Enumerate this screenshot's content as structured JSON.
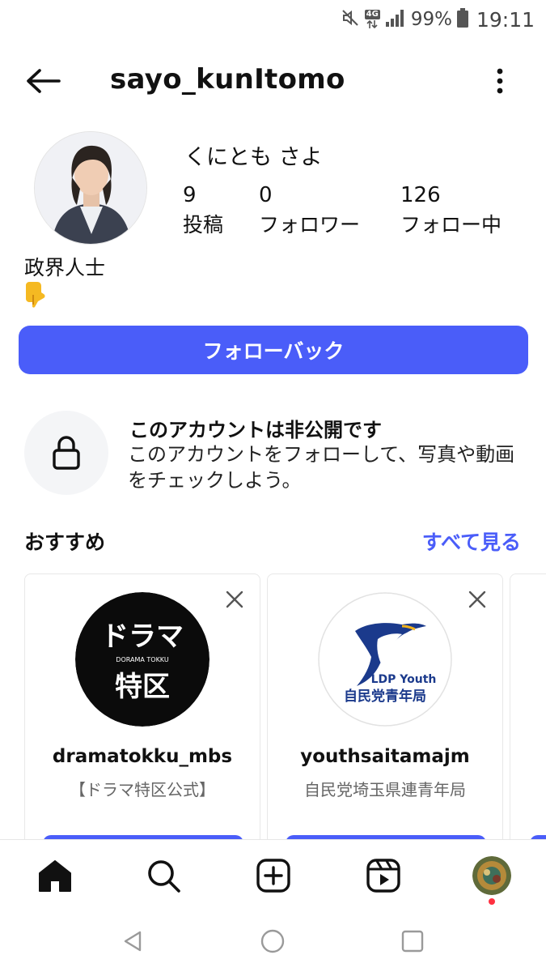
{
  "status_bar": {
    "network": "4G",
    "battery": "99%",
    "time": "19:11",
    "icons": [
      "mute-icon",
      "data-arrows-icon",
      "signal-icon",
      "battery-icon"
    ]
  },
  "header": {
    "username": "sayo_kunItomo",
    "back_icon": "arrow-left-icon",
    "more_icon": "more-vertical-icon"
  },
  "profile": {
    "display_name": "くにとも さよ",
    "stats": [
      {
        "value": "9",
        "label": "投稿"
      },
      {
        "value": "0",
        "label": "フォロワー"
      },
      {
        "value": "126",
        "label": "フォロー中"
      }
    ],
    "bio": "政界人士",
    "bio_emoji": "point-down-emoji"
  },
  "actions": {
    "follow_back_label": "フォローバック"
  },
  "private_notice": {
    "title": "このアカウントは非公開です",
    "description": "このアカウントをフォローして、写真や動画をチェックしよう。",
    "icon": "lock-icon"
  },
  "recommendations": {
    "title": "おすすめ",
    "see_all": "すべて見る",
    "cards": [
      {
        "username": "dramatokku_mbs",
        "subtitle": "【ドラマ特区公式】",
        "logo_text_top": "ドラマ",
        "logo_text_mid": "DORAMA TOKKU",
        "logo_text_bottom": "特区"
      },
      {
        "username": "youthsaitamajm",
        "subtitle": "自民党埼玉県連青年局",
        "logo_text_top": "LDP Youth",
        "logo_text_bottom": "自民党青年局"
      }
    ]
  },
  "bottom_nav": {
    "items": [
      "home-icon",
      "search-icon",
      "create-icon",
      "reels-icon",
      "profile-icon"
    ]
  },
  "colors": {
    "accent": "#4a5df9",
    "notification": "#ff3040"
  }
}
